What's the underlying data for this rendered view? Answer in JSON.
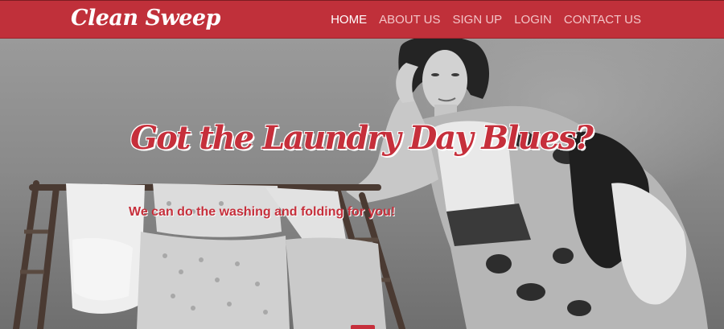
{
  "brand": {
    "name": "Clean Sweep"
  },
  "nav": {
    "items": [
      {
        "label": "HOME",
        "active": true
      },
      {
        "label": "ABOUT US",
        "active": false
      },
      {
        "label": "SIGN UP",
        "active": false
      },
      {
        "label": "LOGIN",
        "active": false
      },
      {
        "label": "CONTACT US",
        "active": false
      }
    ]
  },
  "hero": {
    "title": "Got the Laundry Day Blues?",
    "subtitle": "We can do the washing and folding for you!"
  },
  "colors": {
    "brand_red": "#c0303a",
    "text_red": "#c62f3b",
    "nav_active": "#ffffff",
    "nav_inactive": "#f3c4c7"
  }
}
